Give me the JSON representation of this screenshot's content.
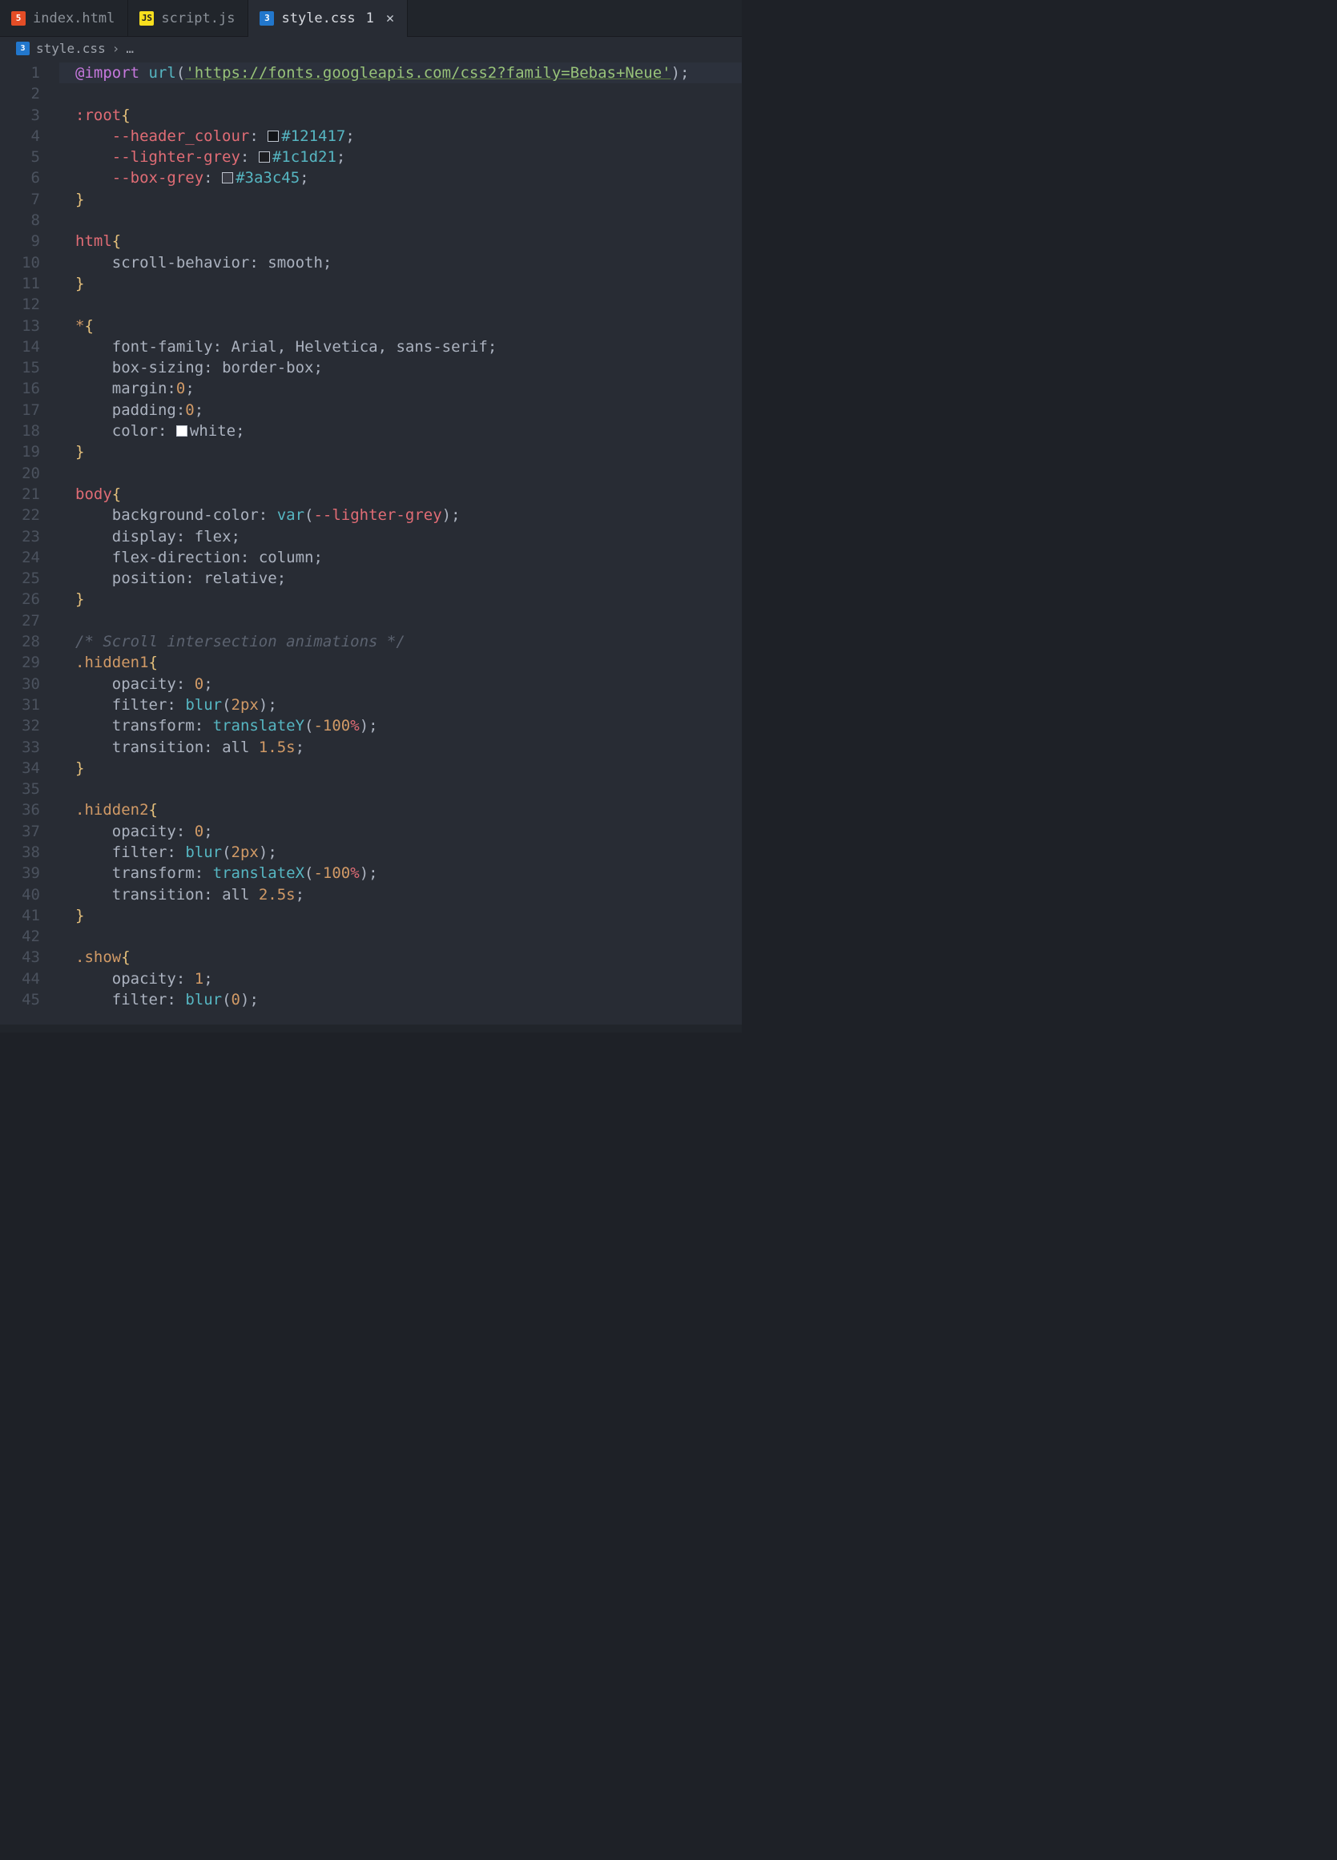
{
  "tabs": [
    {
      "icon": "html",
      "label": "index.html",
      "active": false,
      "dirty": false
    },
    {
      "icon": "js",
      "label": "script.js",
      "active": false,
      "dirty": false
    },
    {
      "icon": "css",
      "label": "style.css",
      "active": true,
      "dirty": true,
      "dirty_indicator": "1",
      "close": "✕"
    }
  ],
  "breadcrumb": {
    "icon": "css",
    "file": "style.css",
    "separator": "›",
    "tail": "…"
  },
  "gutter": {
    "start": 1,
    "end": 45
  },
  "code": {
    "l1": {
      "import_kw": "@import",
      "url_fn": "url",
      "paren_o": "(",
      "url_str": "'https://fonts.googleapis.com/css2?family=Bebas+Neue'",
      "paren_c": ")",
      "semi": ";"
    },
    "l3": {
      "sel": ":root",
      "brace": "{"
    },
    "l4": {
      "var": "--header_colour",
      "colon": ":",
      "hex": "#121417",
      "swatch": "#121417",
      "semi": ";"
    },
    "l5": {
      "var": "--lighter-grey",
      "colon": ":",
      "hex": "#1c1d21",
      "swatch": "#1c1d21",
      "semi": ";"
    },
    "l6": {
      "var": "--box-grey",
      "colon": ":",
      "hex": "#3a3c45",
      "swatch": "#3a3c45",
      "semi": ";"
    },
    "l7": {
      "brace": "}"
    },
    "l9": {
      "sel": "html",
      "brace": "{"
    },
    "l10": {
      "prop": "scroll-behavior",
      "val": "smooth"
    },
    "l11": {
      "brace": "}"
    },
    "l13": {
      "sel": "*",
      "brace": "{"
    },
    "l14": {
      "prop": "font-family",
      "v1": "Arial",
      "v2": "Helvetica",
      "v3": "sans-serif"
    },
    "l15": {
      "prop": "box-sizing",
      "val": "border-box"
    },
    "l16": {
      "prop": "margin",
      "val": "0"
    },
    "l17": {
      "prop": "padding",
      "val": "0"
    },
    "l18": {
      "prop": "color",
      "val": "white",
      "swatch": "#ffffff"
    },
    "l19": {
      "brace": "}"
    },
    "l21": {
      "sel": "body",
      "brace": "{"
    },
    "l22": {
      "prop": "background-color",
      "fn": "var",
      "arg": "--lighter-grey"
    },
    "l23": {
      "prop": "display",
      "val": "flex"
    },
    "l24": {
      "prop": "flex-direction",
      "val": "column"
    },
    "l25": {
      "prop": "position",
      "val": "relative"
    },
    "l26": {
      "brace": "}"
    },
    "l28": {
      "comment": "/* Scroll intersection animations */"
    },
    "l29": {
      "sel": ".hidden1",
      "brace": "{"
    },
    "l30": {
      "prop": "opacity",
      "val": "0"
    },
    "l31": {
      "prop": "filter",
      "fn": "blur",
      "arg": "2px"
    },
    "l32": {
      "prop": "transform",
      "fn": "translateY",
      "arg": "-100%"
    },
    "l33": {
      "prop": "transition",
      "v1": "all",
      "v2": "1.5s"
    },
    "l34": {
      "brace": "}"
    },
    "l36": {
      "sel": ".hidden2",
      "brace": "{"
    },
    "l37": {
      "prop": "opacity",
      "val": "0"
    },
    "l38": {
      "prop": "filter",
      "fn": "blur",
      "arg": "2px"
    },
    "l39": {
      "prop": "transform",
      "fn": "translateX",
      "arg": "-100%"
    },
    "l40": {
      "prop": "transition",
      "v1": "all",
      "v2": "2.5s"
    },
    "l41": {
      "brace": "}"
    },
    "l43": {
      "sel": ".show",
      "brace": "{"
    },
    "l44": {
      "prop": "opacity",
      "val": "1"
    },
    "l45": {
      "prop": "filter",
      "fn": "blur",
      "arg": "0"
    }
  }
}
